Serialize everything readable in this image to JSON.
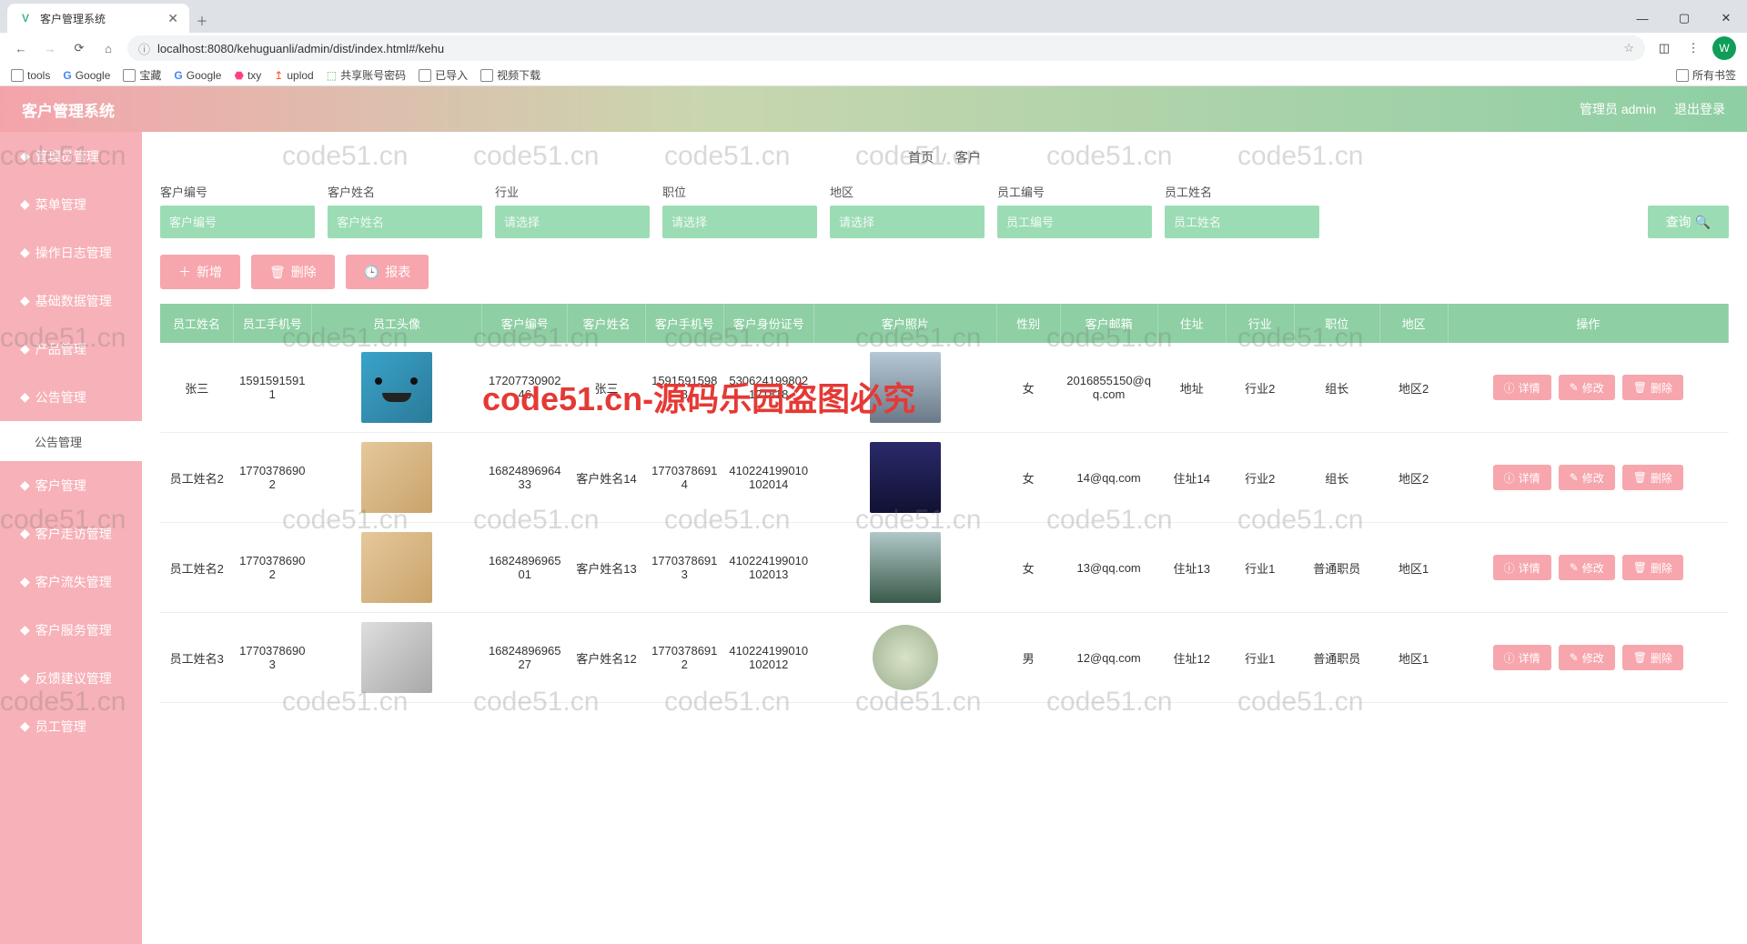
{
  "browser": {
    "tab_title": "客户管理系统",
    "url": "localhost:8080/kehuguanli/admin/dist/index.html#/kehu",
    "avatar_letter": "W",
    "bookmarks": [
      "tools",
      "Google",
      "宝藏",
      "Google",
      "txy",
      "uplod",
      "共享账号密码",
      "已导入",
      "视频下载"
    ],
    "all_bookmarks": "所有书签"
  },
  "header": {
    "brand": "客户管理系统",
    "admin_label": "管理员 admin",
    "logout": "退出登录"
  },
  "sidebar": {
    "items": [
      {
        "label": "管理员管理"
      },
      {
        "label": "菜单管理"
      },
      {
        "label": "操作日志管理"
      },
      {
        "label": "基础数据管理"
      },
      {
        "label": "产品管理"
      },
      {
        "label": "公告管理"
      },
      {
        "label": "公告管理",
        "sub": true
      },
      {
        "label": "客户管理"
      },
      {
        "label": "客户走访管理"
      },
      {
        "label": "客户流失管理"
      },
      {
        "label": "客户服务管理"
      },
      {
        "label": "反馈建议管理"
      },
      {
        "label": "员工管理"
      }
    ]
  },
  "breadcrumb": {
    "home": "首页",
    "sep": "/",
    "current": "客户"
  },
  "search": {
    "labels": [
      "客户编号",
      "客户姓名",
      "行业",
      "职位",
      "地区",
      "员工编号",
      "员工姓名"
    ],
    "placeholders": [
      "客户编号",
      "客户姓名",
      "请选择",
      "请选择",
      "请选择",
      "员工编号",
      "员工姓名"
    ],
    "query_btn": "查询"
  },
  "actions": {
    "add": "新增",
    "delete": "删除",
    "report": "报表"
  },
  "table": {
    "headers": [
      "员工姓名",
      "员工手机号",
      "员工头像",
      "客户编号",
      "客户姓名",
      "客户手机号",
      "客户身份证号",
      "客户照片",
      "性别",
      "客户邮箱",
      "住址",
      "行业",
      "职位",
      "地区",
      "操作"
    ],
    "ops": {
      "detail": "详情",
      "edit": "修改",
      "del": "删除"
    },
    "rows": [
      {
        "emp_name": "张三",
        "emp_phone": "15915915911",
        "cust_no": "1720773090246",
        "cust_name": "张三",
        "cust_phone": "15915915988",
        "cust_id": "530624199802121818",
        "gender": "女",
        "email": "2016855150@qq.com",
        "addr": "地址",
        "industry": "行业2",
        "position": "组长",
        "area": "地区2"
      },
      {
        "emp_name": "员工姓名2",
        "emp_phone": "17703786902",
        "cust_no": "1682489696433",
        "cust_name": "客户姓名14",
        "cust_phone": "17703786914",
        "cust_id": "410224199010102014",
        "gender": "女",
        "email": "14@qq.com",
        "addr": "住址14",
        "industry": "行业2",
        "position": "组长",
        "area": "地区2"
      },
      {
        "emp_name": "员工姓名2",
        "emp_phone": "17703786902",
        "cust_no": "1682489696501",
        "cust_name": "客户姓名13",
        "cust_phone": "17703786913",
        "cust_id": "410224199010102013",
        "gender": "女",
        "email": "13@qq.com",
        "addr": "住址13",
        "industry": "行业1",
        "position": "普通职员",
        "area": "地区1"
      },
      {
        "emp_name": "员工姓名3",
        "emp_phone": "17703786903",
        "cust_no": "1682489696527",
        "cust_name": "客户姓名12",
        "cust_phone": "17703786912",
        "cust_id": "410224199010102012",
        "gender": "男",
        "email": "12@qq.com",
        "addr": "住址12",
        "industry": "行业1",
        "position": "普通职员",
        "area": "地区1"
      }
    ]
  },
  "watermark_text": "code51.cn",
  "big_watermark": "code51.cn-源码乐园盗图必究"
}
